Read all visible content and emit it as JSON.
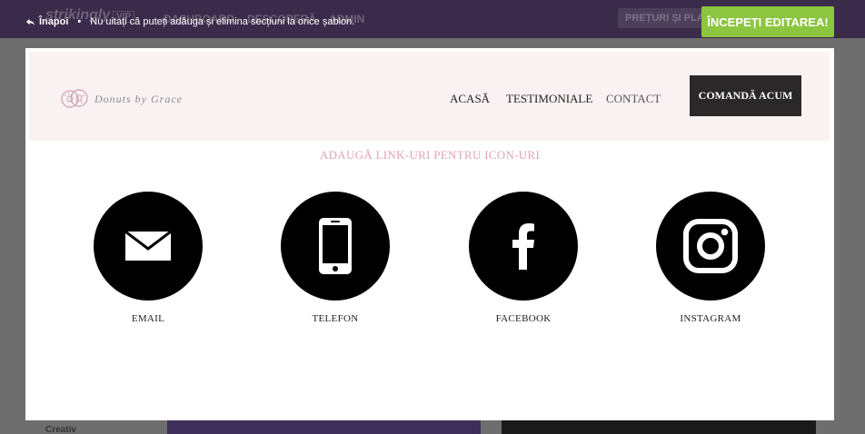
{
  "background": {
    "logo": "strikingly",
    "vip": "VIP",
    "nav": [
      "DASHBOARD",
      "DESCOPERĂ",
      "ADMIN"
    ],
    "pricing": "PREȚURI ȘI PLANURI",
    "side_label": "Creativ"
  },
  "topbar": {
    "back_label": "Înapoi",
    "hint": "Nu uitați că puteți adăuga și elimina secțiuni la orice șablon.",
    "start_button": "ÎNCEPEȚI EDITAREA!"
  },
  "site": {
    "brand": "Donuts by Grace",
    "nav": [
      "ACASĂ",
      "TESTIMONIALE",
      "CONTACT"
    ],
    "order_button": "COMANDĂ ACUM"
  },
  "section": {
    "title": "ADAUGĂ LINK-URI PENTRU ICON-URI",
    "icons": [
      {
        "label": "EMAIL",
        "icon": "envelope-icon"
      },
      {
        "label": "TELEFON",
        "icon": "phone-icon"
      },
      {
        "label": "FACEBOOK",
        "icon": "facebook-icon"
      },
      {
        "label": "INSTAGRAM",
        "icon": "instagram-icon"
      }
    ]
  },
  "colors": {
    "accent_green": "#8cc53f",
    "header_bg": "#faf2f2",
    "title_pink": "#e0a3b5",
    "button_dark": "#2a2828"
  }
}
